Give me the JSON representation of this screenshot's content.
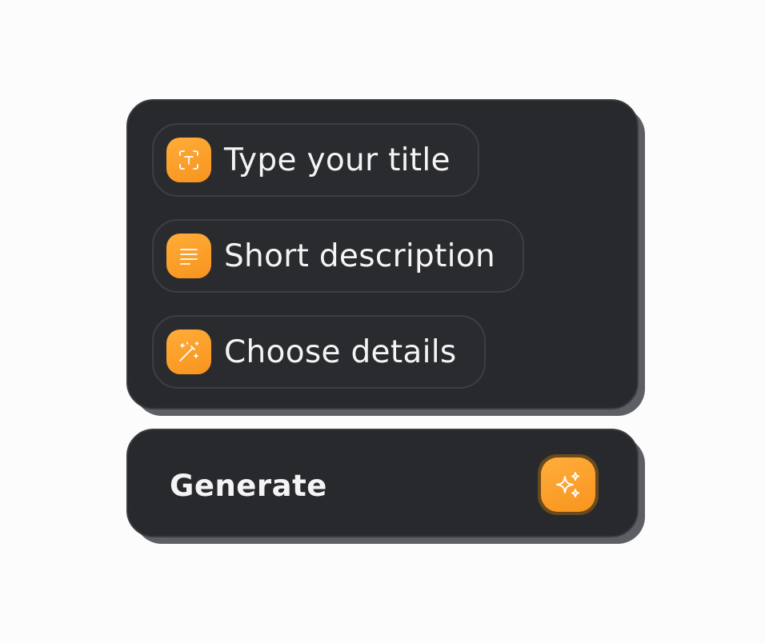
{
  "form": {
    "fields": [
      {
        "label": "Type your title",
        "icon": "text-frame-icon"
      },
      {
        "label": "Short description",
        "icon": "lines-icon"
      },
      {
        "label": "Choose details",
        "icon": "magic-wand-icon"
      }
    ]
  },
  "generate": {
    "label": "Generate",
    "icon": "sparkles-icon"
  },
  "colors": {
    "panel": "#28292c",
    "shadow": "#5d5f65",
    "accent": "#f8951e",
    "text": "#f4f4f6"
  }
}
